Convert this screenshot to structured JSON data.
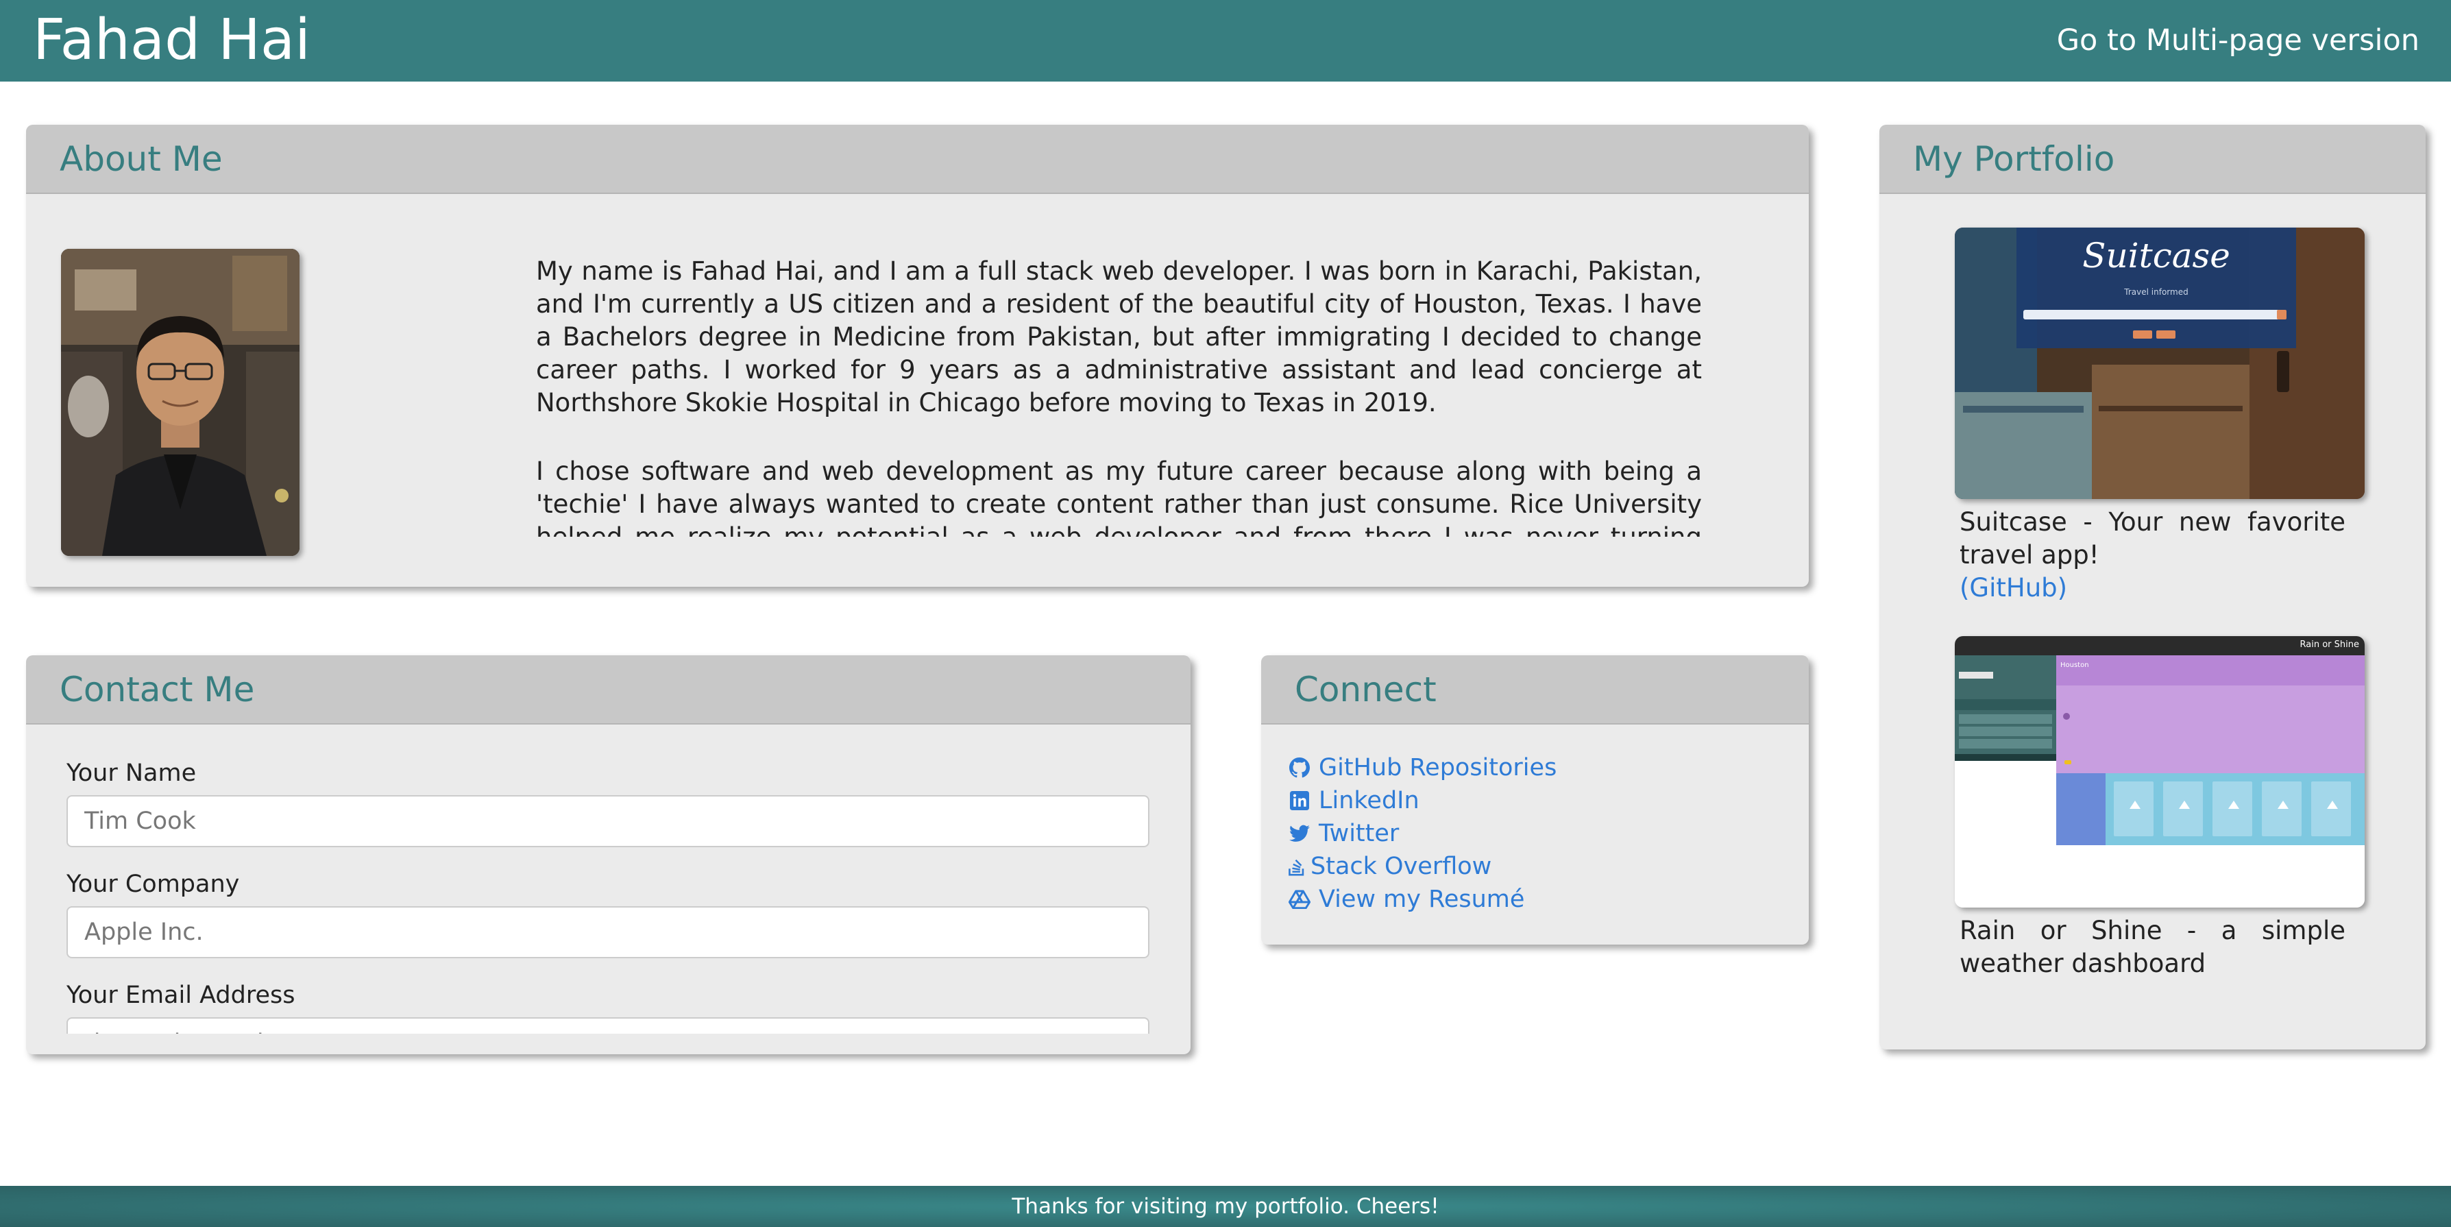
{
  "header": {
    "title": "Fahad Hai",
    "multipage_link": "Go to Multi-page version"
  },
  "about": {
    "title": "About Me",
    "paragraphs": [
      "My name is Fahad Hai, and I am a full stack web developer. I was born in Karachi, Pakistan, and I'm currently a US citizen and a resident of the beautiful city of Houston, Texas. I have a Bachelors degree in Medicine from Pakistan, but after immigrating I decided to change career paths. I worked for 9 years as a administrative assistant and lead concierge at Northshore Skokie Hospital in Chicago before moving to Texas in 2019.",
      "I chose software and web development as my future career because along with being a 'techie' I have always wanted to create content rather than just consume. Rice University helped me realize my potential as a web developer and from there I was never turning back."
    ]
  },
  "contact": {
    "title": "Contact Me",
    "fields": [
      {
        "label": "Your Name",
        "placeholder": "Tim Cook"
      },
      {
        "label": "Your Company",
        "placeholder": "Apple Inc."
      },
      {
        "label": "Your Email Address",
        "placeholder": "tim.cook@apple.com"
      }
    ]
  },
  "connect": {
    "title": "Connect",
    "links": [
      {
        "label": "GitHub Repositories",
        "icon": "github-icon"
      },
      {
        "label": "LinkedIn",
        "icon": "linkedin-icon"
      },
      {
        "label": "Twitter",
        "icon": "twitter-icon"
      },
      {
        "label": "Stack Overflow",
        "icon": "stack-overflow-icon"
      },
      {
        "label": "View my Resumé",
        "icon": "google-drive-icon"
      }
    ]
  },
  "portfolio": {
    "title": "My Portfolio",
    "projects": [
      {
        "description": "Suitcase - Your new favorite travel app!",
        "link": "(GitHub)",
        "screenshot_title": "Suitcase",
        "screenshot_subtitle": "Travel informed"
      },
      {
        "description": "Rain or Shine - a simple weather dashboard",
        "screenshot_title": "Rain or Shine",
        "screenshot_city": "Houston"
      }
    ]
  },
  "footer": {
    "text": "Thanks for visiting my portfolio. Cheers!"
  },
  "colors": {
    "accent": "#377e80",
    "link": "#2e7bd6",
    "card_background": "#ebebeb",
    "card_header": "#c8c8c8"
  }
}
